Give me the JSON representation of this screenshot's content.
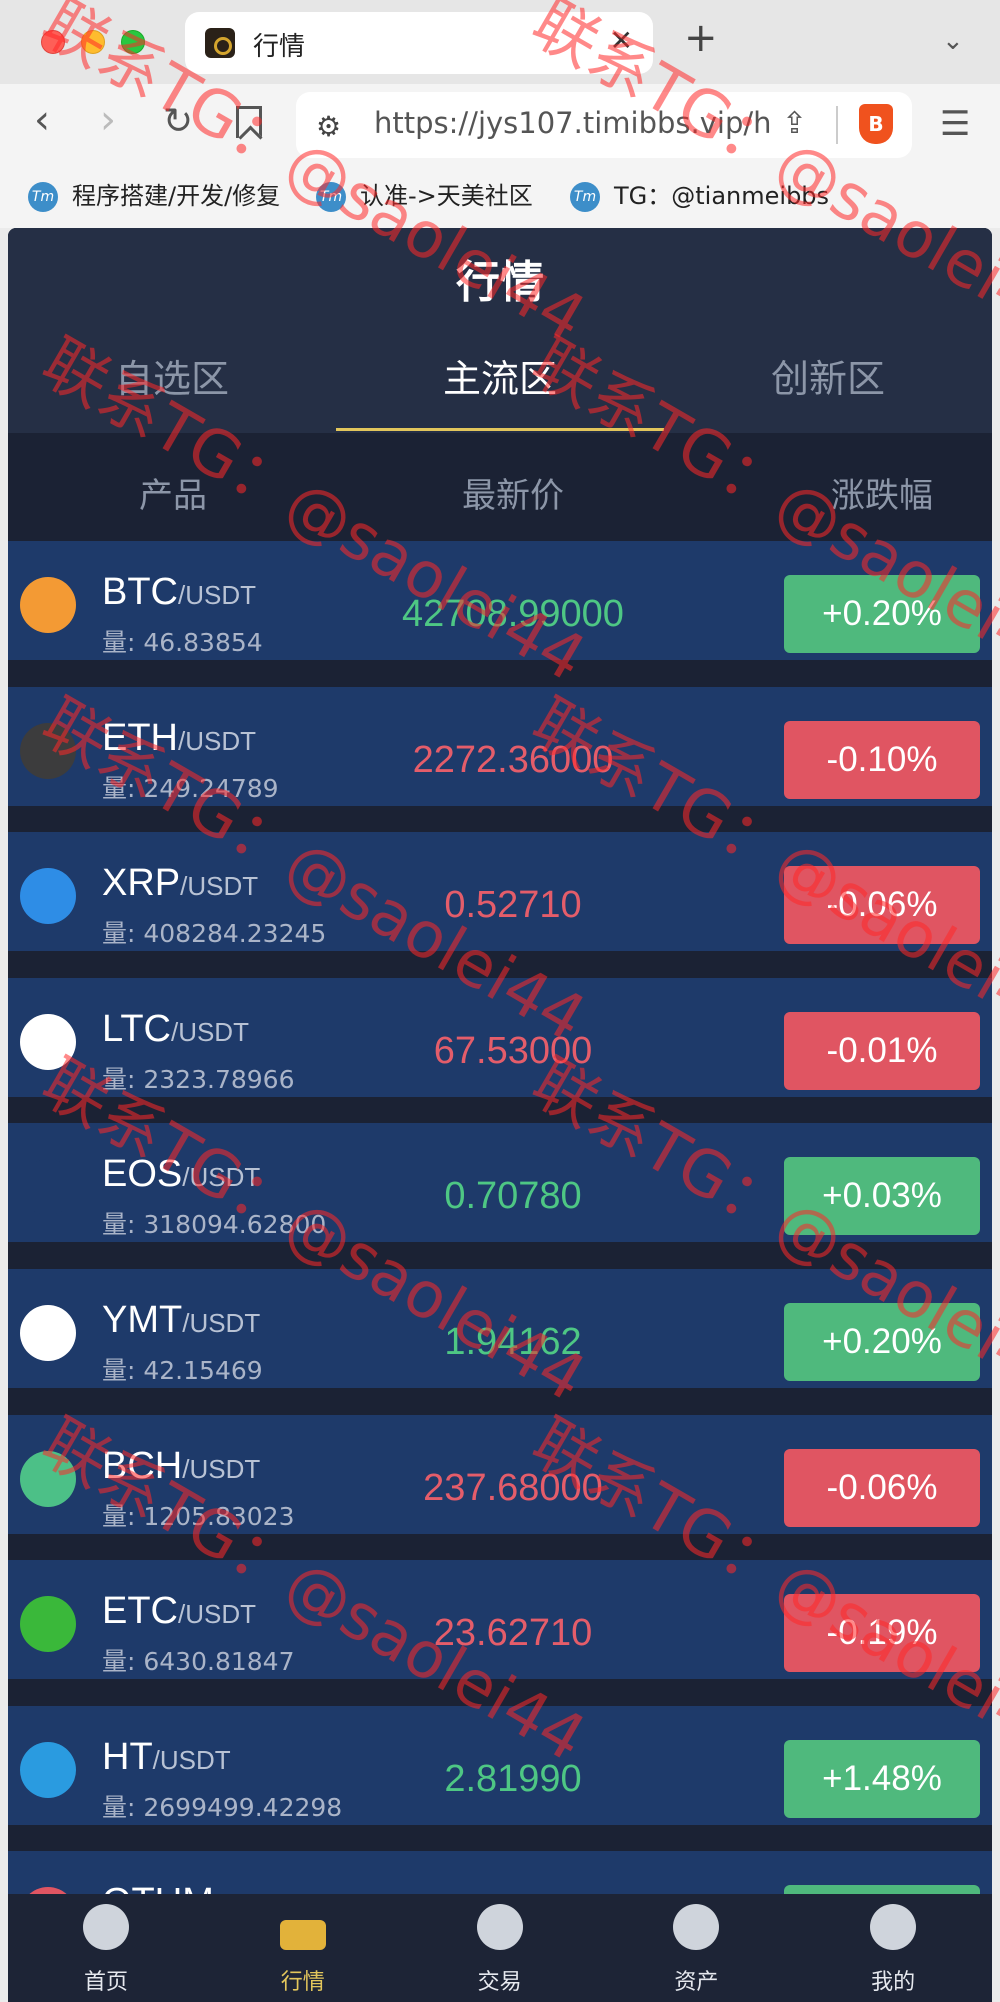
{
  "browser": {
    "tab_title": "行情",
    "close_glyph": "✕",
    "new_tab_glyph": "+",
    "url": "https://jys107.timibbs.vip/h...",
    "bookmarks": [
      {
        "label": "程序搭建/开发/修复"
      },
      {
        "label": "认准->天美社区"
      },
      {
        "label": "TG：@tianmeibbs"
      }
    ]
  },
  "app": {
    "title": "行情",
    "category_tabs": [
      "自选区",
      "主流区",
      "创新区"
    ],
    "active_tab": "主流区",
    "columns": {
      "product": "产品",
      "price": "最新价",
      "change": "涨跌幅"
    },
    "quote_suffix": "/USDT",
    "rows": [
      {
        "symbol": "BTC",
        "volume": "量: 46.83854",
        "price": "42708.99000",
        "change": "+0.20%",
        "direction": "up",
        "icon_color": "#f39a34",
        "icon": "bitcoin-icon"
      },
      {
        "symbol": "ETH",
        "volume": "量: 249.24789",
        "price": "2272.36000",
        "change": "-0.10%",
        "direction": "down",
        "icon_color": "#3c3c3d",
        "icon": "ethereum-icon"
      },
      {
        "symbol": "XRP",
        "volume": "量: 408284.23245",
        "price": "0.52710",
        "change": "-0.06%",
        "direction": "down",
        "icon_color": "#2e8de6",
        "icon": "ripple-icon"
      },
      {
        "symbol": "LTC",
        "volume": "量: 2323.78966",
        "price": "67.53000",
        "change": "-0.01%",
        "direction": "down",
        "icon_color": "#ffffff",
        "icon": "litecoin-icon"
      },
      {
        "symbol": "EOS",
        "volume": "量: 318094.62800",
        "price": "0.70780",
        "change": "+0.03%",
        "direction": "up",
        "icon_color": "#1e3a6a",
        "icon": "eos-icon"
      },
      {
        "symbol": "YMT",
        "volume": "量: 42.15469",
        "price": "1.94162",
        "change": "+0.20%",
        "direction": "up",
        "icon_color": "#ffffff",
        "icon": "ymt-icon"
      },
      {
        "symbol": "BCH",
        "volume": "量: 1205.83023",
        "price": "237.68000",
        "change": "-0.06%",
        "direction": "down",
        "icon_color": "#4cc087",
        "icon": "bitcoin-cash-icon"
      },
      {
        "symbol": "ETC",
        "volume": "量: 6430.81847",
        "price": "23.62710",
        "change": "-0.19%",
        "direction": "down",
        "icon_color": "#3ab83a",
        "icon": "ethereum-classic-icon"
      },
      {
        "symbol": "HT",
        "volume": "量: 2699499.42298",
        "price": "2.81990",
        "change": "+1.48%",
        "direction": "up",
        "icon_color": "#2a9be0",
        "icon": "huobi-token-icon"
      },
      {
        "symbol": "QTUM",
        "volume": "",
        "price": "",
        "change": "",
        "direction": "up",
        "icon_color": "#e05562",
        "icon": "qtum-icon"
      }
    ]
  },
  "bottom_nav": [
    {
      "label": "首页",
      "icon": "home-icon"
    },
    {
      "label": "行情",
      "icon": "market-icon"
    },
    {
      "label": "交易",
      "icon": "trade-icon"
    },
    {
      "label": "资产",
      "icon": "wallet-icon"
    },
    {
      "label": "我的",
      "icon": "profile-icon"
    }
  ],
  "active_nav": "行情",
  "watermark": "联系TG：@saolei44",
  "colors": {
    "up": "#4fb97d",
    "down": "#e05562",
    "accent": "#e2c65c",
    "row_bg": "#1e3a6a",
    "page_bg": "#1b2234"
  }
}
